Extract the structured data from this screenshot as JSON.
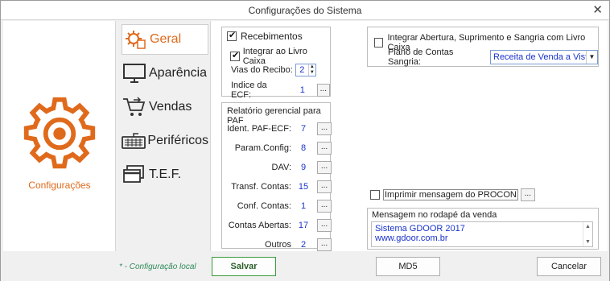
{
  "window": {
    "title": "Configurações do Sistema",
    "close": "✕"
  },
  "left": {
    "label": "Configurações",
    "accent": "#e06a1c"
  },
  "nav": [
    {
      "label": "Geral",
      "icon": "gear-icon",
      "active": true
    },
    {
      "label": "Aparência",
      "icon": "monitor-icon"
    },
    {
      "label": "Vendas",
      "icon": "cart-icon"
    },
    {
      "label": "Periféricos",
      "icon": "keyboard-icon"
    },
    {
      "label": "T.E.F.",
      "icon": "card-icon"
    }
  ],
  "recebimentos": {
    "title": "Recebimentos",
    "checked": true,
    "integrar_label": "Integrar ao Livro Caixa",
    "integrar_checked": true,
    "vias_label": "Vias do Recibo:",
    "vias_value": "2",
    "indice_label": "Indice da ECF:",
    "indice_value": "1"
  },
  "relatorio": {
    "title": "Relatório gerencial para PAF",
    "rows": [
      {
        "label": "Ident. PAF-ECF:",
        "value": "7"
      },
      {
        "label": "Param.Config:",
        "value": "8"
      },
      {
        "label": "DAV:",
        "value": "9"
      },
      {
        "label": "Transf. Contas:",
        "value": "15"
      },
      {
        "label": "Conf. Contas:",
        "value": "1"
      },
      {
        "label": "Contas Abertas:",
        "value": "17"
      },
      {
        "label": "Outros",
        "value": "2"
      }
    ],
    "button": "..."
  },
  "sangria": {
    "integrar_label": "Integrar Abertura, Suprimento e Sangria com Livro Caixa",
    "integrar_checked": false,
    "plano_label": "Plano de Contas Sangria:",
    "plano_value": "Receita de Venda a Vista"
  },
  "procon": {
    "label": "Imprimir mensagem do PROCON",
    "checked": false,
    "button": "..."
  },
  "rodape": {
    "title": "Mensagem no rodapé da venda",
    "line1": "Sistema GDOOR 2017",
    "line2": "www.gdoor.com.br"
  },
  "footer": {
    "note": "* - Configuração local",
    "salvar": "Salvar",
    "md5": "MD5",
    "cancelar": "Cancelar"
  }
}
